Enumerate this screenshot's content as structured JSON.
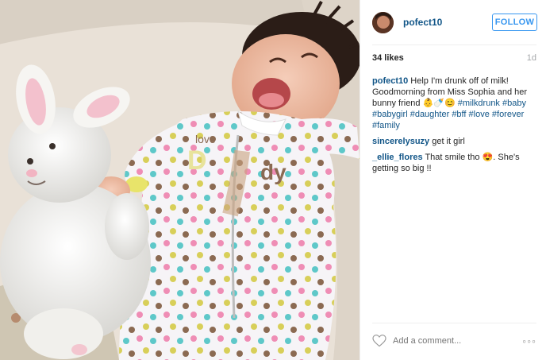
{
  "post": {
    "username": "pofect10",
    "follow_label": "FOLLOW",
    "likes": "34 likes",
    "time_ago": "1d",
    "caption": {
      "user": "pofect10",
      "text": " Help I'm drunk off of milk! Goodmorning from Miss Sophia and her bunny friend 👶🍼😊 ",
      "tags": [
        "#milkdrunk",
        "#baby",
        "#babygirl",
        "#daughter",
        "#bff",
        "#love",
        "#forever",
        "#family"
      ]
    },
    "comments": [
      {
        "user": "sincerelysuzy",
        "text": " get it girl"
      },
      {
        "user": "_ellie_flores",
        "text": " That smile tho 😍. She's getting so big !!"
      }
    ],
    "add_comment_placeholder": "Add a comment...",
    "more_label": "◦◦◦",
    "icons": {
      "avatar": "profile-avatar",
      "heart": "heart-icon",
      "more": "more-options-icon"
    },
    "colors": {
      "link": "#125688",
      "follow": "#3897f0",
      "muted": "#a5a7aa"
    }
  }
}
